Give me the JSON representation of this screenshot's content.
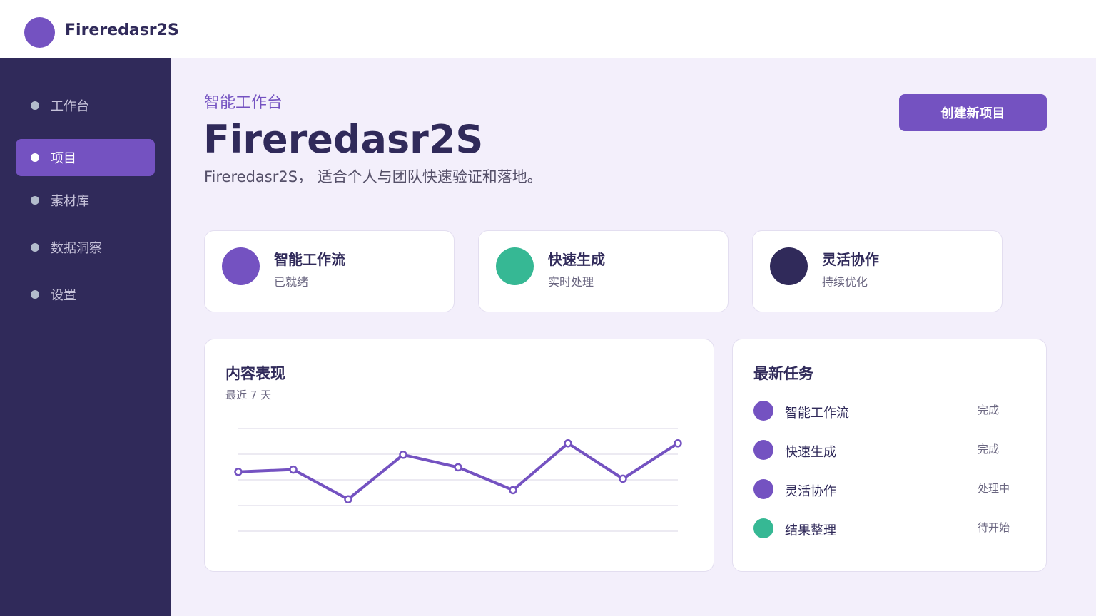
{
  "app": {
    "brand": "Fireredasr2S"
  },
  "sidebar": {
    "items": [
      {
        "label": "工作台",
        "active": false
      },
      {
        "label": "项目",
        "active": true
      },
      {
        "label": "素材库",
        "active": false
      },
      {
        "label": "数据洞察",
        "active": false
      },
      {
        "label": "设置",
        "active": false
      }
    ]
  },
  "header": {
    "eyebrow": "智能工作台",
    "title": "Fireredasr2S",
    "subtitle": "Fireredasr2S， 适合个人与团队快速验证和落地。",
    "create_button": "创建新项目"
  },
  "stats": [
    {
      "title": "智能工作流",
      "sub": "已就绪",
      "color": "#7452c1"
    },
    {
      "title": "快速生成",
      "sub": "实时处理",
      "color": "#36b894"
    },
    {
      "title": "灵活协作",
      "sub": "持续优化",
      "color": "#302a5a"
    }
  ],
  "performance": {
    "title": "内容表现",
    "subtitle": "最近 7 天"
  },
  "chart_data": {
    "type": "line",
    "x": [
      1,
      2,
      3,
      4,
      5,
      6,
      7,
      8,
      9
    ],
    "values": [
      52,
      54,
      28,
      67,
      56,
      36,
      77,
      46,
      77
    ],
    "ylim": [
      0,
      90
    ],
    "grid": true,
    "color": "#7452c1"
  },
  "tasks": {
    "title": "最新任务",
    "items": [
      {
        "name": "智能工作流",
        "status": "完成",
        "color": "#7452c1"
      },
      {
        "name": "快速生成",
        "status": "完成",
        "color": "#7452c1"
      },
      {
        "name": "灵活协作",
        "status": "处理中",
        "color": "#7452c1"
      },
      {
        "name": "结果整理",
        "status": "待开始",
        "color": "#36b894"
      }
    ]
  }
}
